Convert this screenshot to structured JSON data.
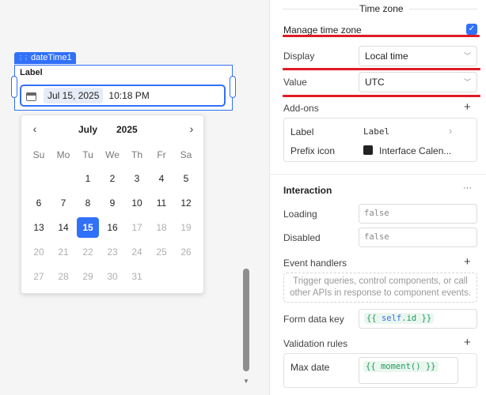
{
  "canvas": {
    "component_name": "dateTime1",
    "field_label": "Label",
    "date_value": "Jul 15, 2025",
    "time_value": "10:18 PM",
    "calendar": {
      "month": "July",
      "year": "2025",
      "weekdays": [
        "Su",
        "Mo",
        "Tu",
        "We",
        "Th",
        "Fr",
        "Sa"
      ],
      "weeks": [
        [
          {
            "d": "",
            "m": false
          },
          {
            "d": "",
            "m": false
          },
          {
            "d": "1",
            "m": false
          },
          {
            "d": "2",
            "m": false
          },
          {
            "d": "3",
            "m": false
          },
          {
            "d": "4",
            "m": false
          },
          {
            "d": "5",
            "m": false
          }
        ],
        [
          {
            "d": "6",
            "m": false
          },
          {
            "d": "7",
            "m": false
          },
          {
            "d": "8",
            "m": false
          },
          {
            "d": "9",
            "m": false
          },
          {
            "d": "10",
            "m": false
          },
          {
            "d": "11",
            "m": false
          },
          {
            "d": "12",
            "m": false
          }
        ],
        [
          {
            "d": "13",
            "m": false
          },
          {
            "d": "14",
            "m": false
          },
          {
            "d": "15",
            "m": false,
            "sel": true
          },
          {
            "d": "16",
            "m": false
          },
          {
            "d": "17",
            "m": true
          },
          {
            "d": "18",
            "m": true
          },
          {
            "d": "19",
            "m": true
          }
        ],
        [
          {
            "d": "20",
            "m": true
          },
          {
            "d": "21",
            "m": true
          },
          {
            "d": "22",
            "m": true
          },
          {
            "d": "23",
            "m": true
          },
          {
            "d": "24",
            "m": true
          },
          {
            "d": "25",
            "m": true
          },
          {
            "d": "26",
            "m": true
          }
        ],
        [
          {
            "d": "27",
            "m": true
          },
          {
            "d": "28",
            "m": true
          },
          {
            "d": "29",
            "m": true
          },
          {
            "d": "30",
            "m": true
          },
          {
            "d": "31",
            "m": true
          },
          {
            "d": "",
            "m": true
          },
          {
            "d": "",
            "m": true
          }
        ]
      ]
    }
  },
  "inspector": {
    "timezone_section": "Time zone",
    "manage_tz_label": "Manage time zone",
    "manage_tz_checked": true,
    "display_label": "Display",
    "display_value": "Local time",
    "value_label": "Value",
    "value_value": "UTC",
    "addons_label": "Add-ons",
    "addon_label_key": "Label",
    "addon_label_value": "Label",
    "addon_prefix_key": "Prefix icon",
    "addon_prefix_value": "Interface Calen...",
    "interaction_title": "Interaction",
    "more_glyph": "···",
    "loading_label": "Loading",
    "loading_placeholder": "false",
    "disabled_label": "Disabled",
    "disabled_placeholder": "false",
    "event_handlers_label": "Event handlers",
    "event_handlers_hint": "Trigger queries, control components, or call other APIs in response to component events.",
    "form_data_key_label": "Form data key",
    "form_data_key_open": "{{ ",
    "form_data_key_obj": "self",
    "form_data_key_prop": ".id",
    "form_data_key_close": " }}",
    "validation_label": "Validation rules",
    "max_date_label": "Max date",
    "max_date_value": "{{ moment() }}"
  },
  "colors": {
    "accent": "#3170f9",
    "annotation_red": "#e01b24",
    "code_green": "#1f9c5a"
  }
}
